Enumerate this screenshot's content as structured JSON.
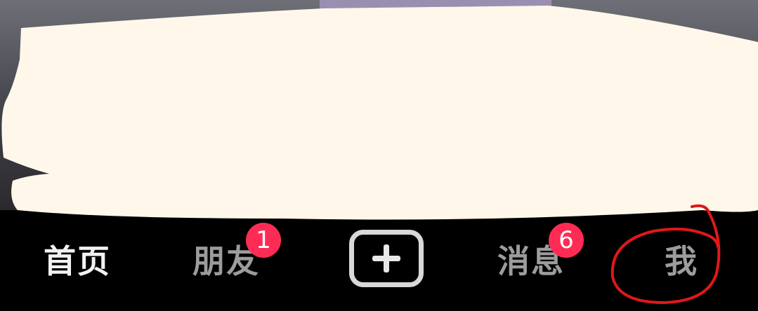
{
  "tabbar": {
    "items": [
      {
        "id": "home",
        "label": "首页",
        "active": true
      },
      {
        "id": "friends",
        "label": "朋友",
        "badge": "1"
      },
      {
        "id": "create",
        "icon": "plus-icon"
      },
      {
        "id": "messages",
        "label": "消息",
        "badge": "6"
      },
      {
        "id": "me",
        "label": "我"
      }
    ]
  },
  "colors": {
    "background": "#000000",
    "active_label": "#f2f2f2",
    "inactive_label": "#9c9c9c",
    "badge": "#fe2c55",
    "scribble": "#fff8ea",
    "annotation": "#e01818"
  }
}
